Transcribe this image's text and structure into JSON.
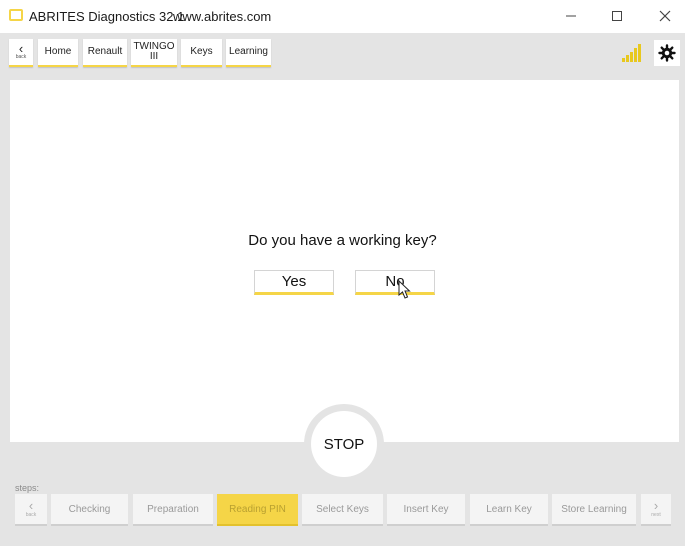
{
  "titlebar": {
    "title": "ABRITES Diagnostics 32.1",
    "url": "www.abrites.com"
  },
  "toolbar": {
    "back_label": "back",
    "breadcrumbs": [
      "Home",
      "Renault",
      "TWINGO III",
      "Keys",
      "Learning"
    ]
  },
  "dialog": {
    "question": "Do you have a working key?",
    "yes_label": "Yes",
    "no_label": "No"
  },
  "stop_label": "STOP",
  "steps": {
    "label": "steps:",
    "back_label": "back",
    "next_label": "next",
    "items": [
      "Checking",
      "Preparation",
      "Reading PIN",
      "Select Keys",
      "Insert Key",
      "Learn Key",
      "Store Learning"
    ],
    "active": "Reading PIN"
  },
  "signal": {
    "bars": 5,
    "filled": 5
  },
  "colors": {
    "accent": "#f5d547",
    "window_bg": "#e4e4e4",
    "panel_bg": "#ffffff"
  },
  "icons": [
    "app-logo-icon",
    "minimize-icon",
    "maximize-icon",
    "close-icon",
    "chevron-left-icon",
    "signal-icon",
    "gear-icon",
    "cursor-icon",
    "chevron-right-icon"
  ]
}
